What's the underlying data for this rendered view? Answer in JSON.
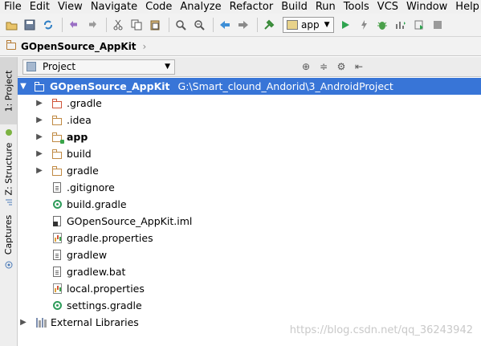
{
  "menu": [
    "File",
    "Edit",
    "View",
    "Navigate",
    "Code",
    "Analyze",
    "Refactor",
    "Build",
    "Run",
    "Tools",
    "VCS",
    "Window",
    "Help"
  ],
  "toolbar": {
    "run_config": "app",
    "icons": [
      "open-icon",
      "save-icon",
      "sync-icon",
      "undo-icon",
      "redo-icon",
      "cut-icon",
      "copy-icon",
      "paste-icon",
      "find-icon",
      "replace-icon",
      "back-icon",
      "forward-icon",
      "make-icon",
      "run-icon",
      "debug-icon",
      "attach-icon",
      "profile-icon",
      "coverage-icon",
      "stop-icon"
    ]
  },
  "breadcrumb": {
    "project": "GOpenSource_AppKit"
  },
  "side_tabs": {
    "project": "1: Project",
    "structure": "Z: Structure",
    "captures": "Captures"
  },
  "panel": {
    "view_selector": "Project"
  },
  "tree": {
    "root": {
      "name": "GOpenSource_AppKit",
      "path": "G:\\Smart_clound_Andorid\\3_AndroidProject"
    },
    "items": [
      {
        "name": ".gradle",
        "icon": "folder-red-icon",
        "expandable": true
      },
      {
        "name": ".idea",
        "icon": "folder-icon",
        "expandable": true
      },
      {
        "name": "app",
        "icon": "module-folder-icon",
        "expandable": true,
        "bold": true
      },
      {
        "name": "build",
        "icon": "folder-icon",
        "expandable": true
      },
      {
        "name": "gradle",
        "icon": "folder-icon",
        "expandable": true
      },
      {
        "name": ".gitignore",
        "icon": "text-file-icon",
        "expandable": false
      },
      {
        "name": "build.gradle",
        "icon": "gradle-file-icon",
        "expandable": false
      },
      {
        "name": "GOpenSource_AppKit.iml",
        "icon": "iml-file-icon",
        "expandable": false
      },
      {
        "name": "gradle.properties",
        "icon": "properties-file-icon",
        "expandable": false
      },
      {
        "name": "gradlew",
        "icon": "text-file-icon",
        "expandable": false
      },
      {
        "name": "gradlew.bat",
        "icon": "text-file-icon",
        "expandable": false
      },
      {
        "name": "local.properties",
        "icon": "properties-file-icon",
        "expandable": false
      },
      {
        "name": "settings.gradle",
        "icon": "gradle-file-icon",
        "expandable": false
      }
    ],
    "external": "External Libraries"
  },
  "watermark": "https://blog.csdn.net/qq_36243942",
  "colors": {
    "selection": "#3875d7",
    "folder": "#c08a44",
    "gradle": "#2f9c5b"
  }
}
